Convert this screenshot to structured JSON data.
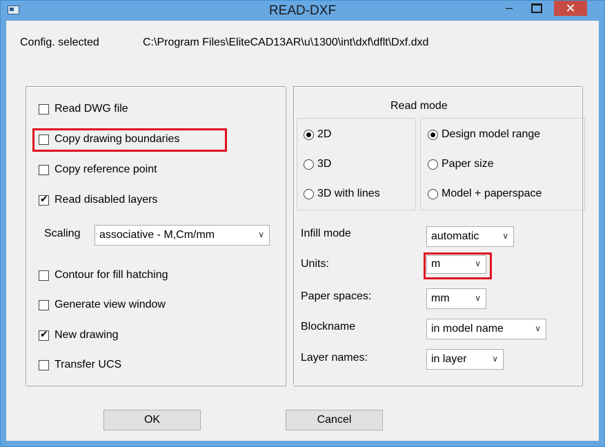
{
  "window": {
    "title": "READ-DXF"
  },
  "config": {
    "label": "Config. selected",
    "path": "C:\\Program Files\\EliteCAD13AR\\u\\1300\\int\\dxf\\dflt\\Dxf.dxd"
  },
  "left": {
    "read_dwg": {
      "label": "Read DWG file",
      "checked": false
    },
    "copy_boundaries": {
      "label": "Copy drawing boundaries",
      "checked": false
    },
    "copy_ref_point": {
      "label": "Copy reference point",
      "checked": false
    },
    "read_disabled_layers": {
      "label": "Read disabled layers",
      "checked": true
    },
    "scaling": {
      "label": "Scaling",
      "value": "associative - M,Cm/mm"
    },
    "contour_fill": {
      "label": "Contour for fill hatching",
      "checked": false
    },
    "gen_view_window": {
      "label": "Generate view window",
      "checked": false
    },
    "new_drawing": {
      "label": "New drawing",
      "checked": true
    },
    "transfer_ucs": {
      "label": "Transfer UCS",
      "checked": false
    }
  },
  "right": {
    "read_mode_title": "Read mode",
    "dim": {
      "options": [
        "2D",
        "3D",
        "3D with lines"
      ],
      "selected": "2D"
    },
    "range": {
      "options": [
        "Design model range",
        "Paper size",
        "Model + paperspace"
      ],
      "selected": "Design model range"
    },
    "infill": {
      "label": "Infill mode",
      "value": "automatic"
    },
    "units": {
      "label": "Units:",
      "value": "m"
    },
    "paper_spaces": {
      "label": "Paper spaces:",
      "value": "mm"
    },
    "blockname": {
      "label": "Blockname",
      "value": "in model name"
    },
    "layer_names": {
      "label": "Layer names:",
      "value": "in layer"
    }
  },
  "buttons": {
    "ok": "OK",
    "cancel": "Cancel"
  },
  "colors": {
    "titlebar": "#67a8e3",
    "close": "#c84b43",
    "highlight": "#e01020"
  },
  "icons": {
    "dropdown": "chevron-down-icon",
    "check": "check-icon"
  }
}
